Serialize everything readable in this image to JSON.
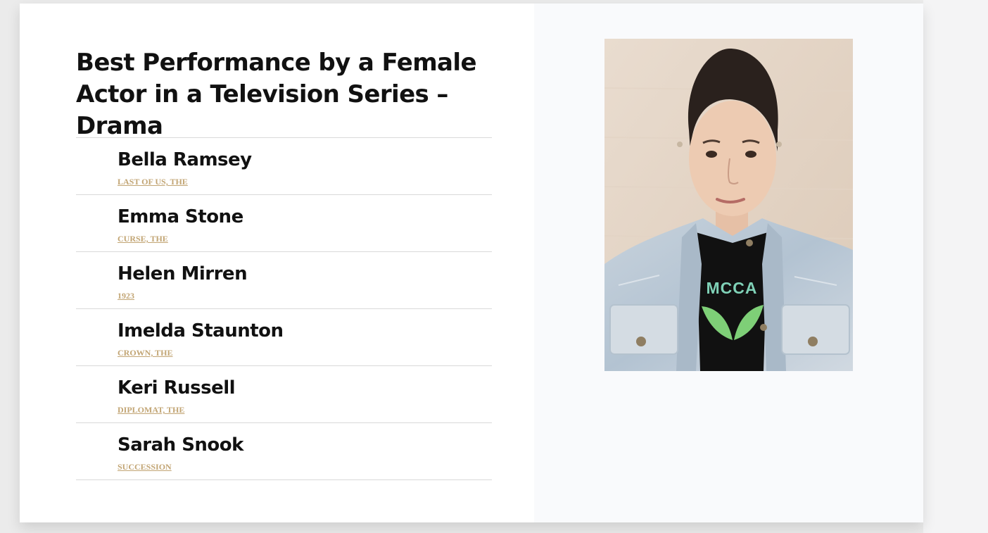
{
  "category": {
    "title": "Best Performance by a Female Actor in a Television Series – Drama"
  },
  "nominees": [
    {
      "name": "Bella Ramsey",
      "show": "LAST OF US, THE"
    },
    {
      "name": "Emma Stone",
      "show": "CURSE, THE"
    },
    {
      "name": "Helen Mirren",
      "show": "1923"
    },
    {
      "name": "Imelda Staunton",
      "show": "CROWN, THE"
    },
    {
      "name": "Keri Russell",
      "show": "DIPLOMAT, THE"
    },
    {
      "name": "Sarah Snook",
      "show": "SUCCESSION"
    }
  ],
  "portrait": {
    "shirt_text": "MCCA"
  },
  "colors": {
    "show_link": "#c2a574",
    "divider": "#d9d9d9",
    "right_panel": "#f9fafc"
  }
}
